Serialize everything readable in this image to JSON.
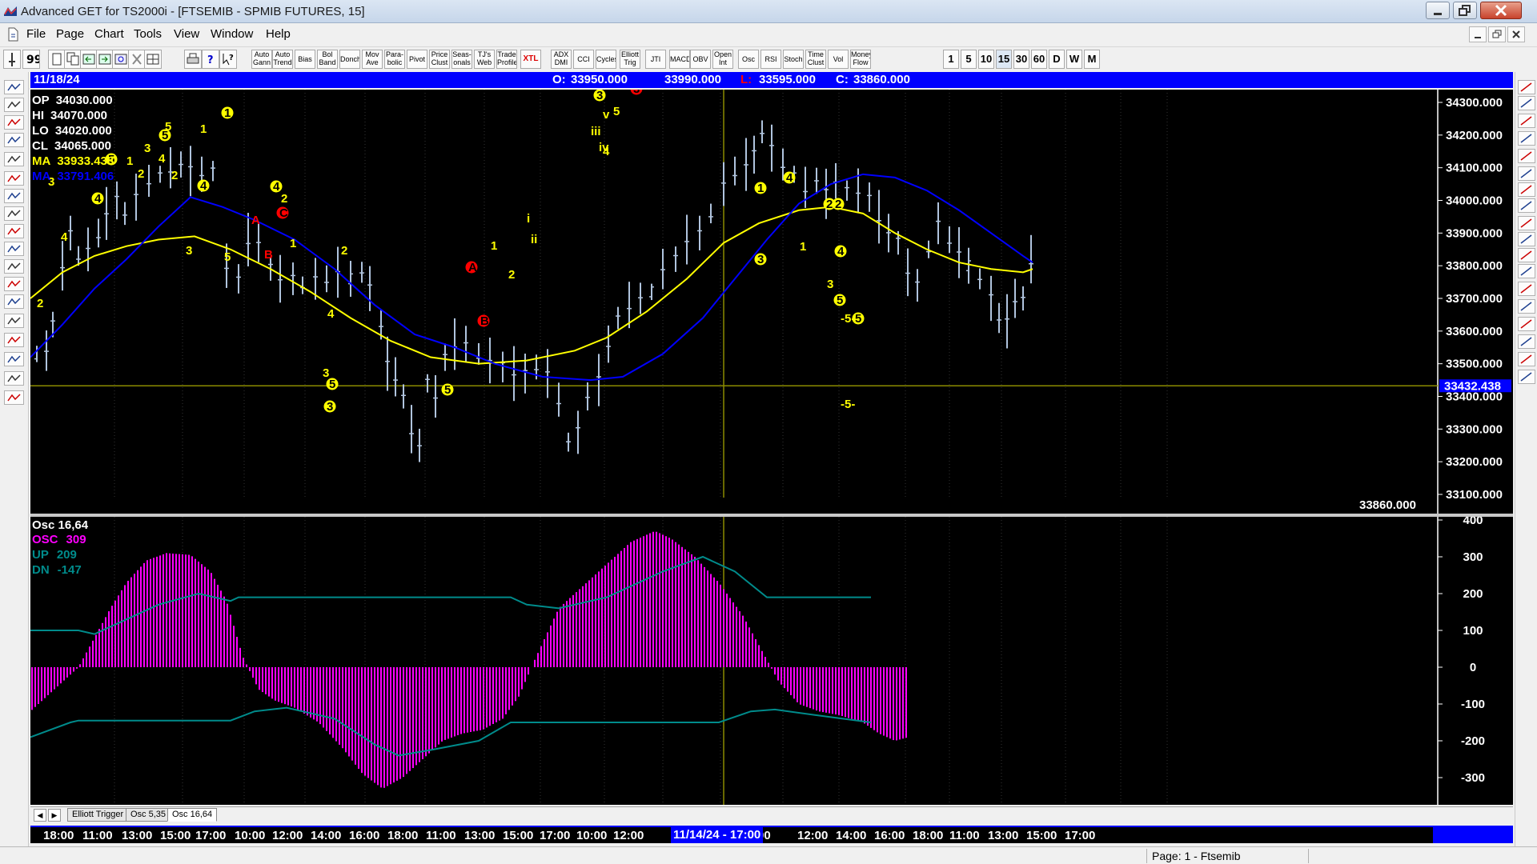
{
  "window": {
    "title": "Advanced GET for TS2000i - [FTSEMIB - SPMIB FUTURES, 15]"
  },
  "menu": [
    "File",
    "Page",
    "Chart",
    "Tools",
    "View",
    "Window",
    "Help"
  ],
  "toolbar": {
    "study_buttons": [
      "Auto Gann",
      "Auto Trend",
      "Bias",
      "Bol Band",
      "Donch",
      "Mov Ave",
      "Para- bolic",
      "Pivot",
      "Price Clust",
      "Seas- onals",
      "TJ's Web",
      "Trade Profile",
      "XTL",
      "ADX DMI",
      "CCI",
      "Cycles",
      "Elliott Trig",
      "JTI",
      "MACD",
      "OBV",
      "Open Int",
      "Osc",
      "RSI",
      "Stoch",
      "Time Clust",
      "Vol",
      "Money Flow"
    ],
    "periods": [
      "1",
      "5",
      "10",
      "15",
      "30",
      "60",
      "D",
      "W",
      "M"
    ],
    "active_period": "15"
  },
  "left_tools": [
    "open",
    "elliott",
    "reset",
    "study",
    "elliott-wave",
    "up",
    "down",
    "left",
    "right",
    "cycle",
    "expand",
    "compress",
    "grid",
    "lines",
    "gann",
    "fib",
    "cross",
    "print"
  ],
  "right_tools": [
    "close",
    "pen",
    "fib-ret",
    "fib-ext",
    "fib-time",
    "hatch",
    "square",
    "circle",
    "ellipse",
    "pti",
    "grid",
    "mob",
    "text-a",
    "zoom",
    "pencil",
    "multi",
    "tools",
    "magnet"
  ],
  "price_header": {
    "date": "11/18/24",
    "open_label": "O:",
    "open": "33950.000",
    "high": "33990.000",
    "low_label": "L:",
    "low": "33595.000",
    "close_label": "C:",
    "close": "33860.000"
  },
  "info_panel": [
    {
      "label": "OP",
      "value": "34030.000",
      "color": "#ffffff"
    },
    {
      "label": "HI",
      "value": "34070.000",
      "color": "#ffffff"
    },
    {
      "label": "LO",
      "value": "34020.000",
      "color": "#ffffff"
    },
    {
      "label": "CL",
      "value": "34065.000",
      "color": "#ffffff"
    },
    {
      "label": "MA",
      "value": "33933.438",
      "color": "#ffff00"
    },
    {
      "label": "MA",
      "value": "33791.406",
      "color": "#0000ff"
    }
  ],
  "price_axis": {
    "ticks": [
      "34300.000",
      "34200.000",
      "34100.000",
      "34000.000",
      "33900.000",
      "33800.000",
      "33700.000",
      "33600.000",
      "33500.000",
      "33400.000",
      "33300.000",
      "33200.000",
      "33100.000"
    ],
    "hline_label": "33432.438",
    "last_price_label": "33860.000"
  },
  "osc_panel": {
    "title": "Osc 16,64",
    "lines": [
      {
        "label": "OSC",
        "value": "309",
        "color": "#ff00ff"
      },
      {
        "label": "UP",
        "value": "209",
        "color": "#008b8b"
      },
      {
        "label": "DN",
        "value": "-147",
        "color": "#008b8b"
      }
    ],
    "ticks": [
      "400",
      "300",
      "200",
      "100",
      "0",
      "-100",
      "-200",
      "-300"
    ]
  },
  "tabs": [
    "Elliott Trigger",
    "Osc 5,35",
    "Osc 16,64"
  ],
  "active_tab": "Osc 16,64",
  "time_axis": {
    "labels": [
      "18:00",
      "11:00",
      "13:00",
      "15:00",
      "17:00",
      "10:00",
      "12:00",
      "14:00",
      "16:00",
      "18:00",
      "11:00",
      "13:00",
      "15:00",
      "17:00",
      "10:00",
      "12:00",
      "00",
      "12:00",
      "14:00",
      "16:00",
      "18:00",
      "11:00",
      "13:00",
      "15:00",
      "17:00"
    ],
    "cursor": "11/14/24 - 17:00"
  },
  "status": {
    "page": "Page: 1 - Ftsemib"
  },
  "elliott_labels": [
    {
      "t": "2",
      "c": "#ffff00"
    },
    {
      "t": "3",
      "c": "#ffff00"
    },
    {
      "t": "4",
      "c": "#ffff00"
    },
    {
      "t": "4",
      "c": "#ffff00"
    },
    {
      "t": "5",
      "c": "#ffff00"
    },
    {
      "t": "1",
      "c": "#ffff00"
    },
    {
      "t": "2",
      "c": "#ffff00"
    },
    {
      "t": "3",
      "c": "#ffff00"
    },
    {
      "t": "4",
      "c": "#ffff00"
    },
    {
      "t": "5",
      "c": "#ffff00"
    },
    {
      "t": "5",
      "c": "#ffff00"
    },
    {
      "t": "2",
      "c": "#ffff00"
    },
    {
      "t": "1",
      "c": "#ffff00"
    },
    {
      "t": "3",
      "c": "#ffff00"
    },
    {
      "t": "4",
      "c": "#ffff00"
    },
    {
      "t": "5",
      "c": "#ffff00"
    },
    {
      "t": "1",
      "c": "#ffff00"
    },
    {
      "t": "A",
      "c": "#ff0000"
    },
    {
      "t": "B",
      "c": "#ff0000"
    },
    {
      "t": "C",
      "c": "#ff0000"
    },
    {
      "t": "2",
      "c": "#ffff00"
    },
    {
      "t": "1",
      "c": "#ffff00"
    },
    {
      "t": "2",
      "c": "#ffff00"
    },
    {
      "t": "4",
      "c": "#ffff00"
    },
    {
      "t": "3",
      "c": "#ffff00"
    },
    {
      "t": "4",
      "c": "#ffff00"
    },
    {
      "t": "5",
      "c": "#ffff00"
    },
    {
      "t": "3",
      "c": "#ffff00"
    },
    {
      "t": "5",
      "c": "#ffff00"
    },
    {
      "t": "A",
      "c": "#ff0000"
    },
    {
      "t": "B",
      "c": "#ff0000"
    },
    {
      "t": "1",
      "c": "#ffff00"
    },
    {
      "t": "2",
      "c": "#ffff00"
    },
    {
      "t": "i",
      "c": "#ffff00"
    },
    {
      "t": "ii",
      "c": "#ffff00"
    },
    {
      "t": "iii",
      "c": "#ffff00"
    },
    {
      "t": "iv",
      "c": "#ffff00"
    },
    {
      "t": "v",
      "c": "#ffff00"
    },
    {
      "t": "3",
      "c": "#ffff00"
    },
    {
      "t": "5",
      "c": "#ffff00"
    },
    {
      "t": "4",
      "c": "#ffff00"
    },
    {
      "t": "3",
      "c": "#ff0000"
    },
    {
      "t": "2",
      "c": "#ffff00"
    },
    {
      "t": "1",
      "c": "#ffff00"
    },
    {
      "t": "4",
      "c": "#ffff00"
    },
    {
      "t": "2",
      "c": "#ffff00"
    },
    {
      "t": "1",
      "c": "#ffff00"
    },
    {
      "t": "3",
      "c": "#ffff00"
    },
    {
      "t": "4",
      "c": "#ffff00"
    },
    {
      "t": "3",
      "c": "#ffff00"
    },
    {
      "t": "5",
      "c": "#ffff00"
    },
    {
      "t": "5",
      "c": "#ffff00"
    },
    {
      "t": "-5-",
      "c": "#ffff00"
    },
    {
      "t": "-5-",
      "c": "#ffff00"
    }
  ],
  "colors": {
    "chart_bg": "#000000",
    "bars": "#b0c4de",
    "ma_fast": "#ffff00",
    "ma_slow": "#0000ff",
    "osc": "#ff00ff",
    "bands": "#008b8b",
    "hline": "#8b8b00",
    "header": "#0000ff"
  }
}
